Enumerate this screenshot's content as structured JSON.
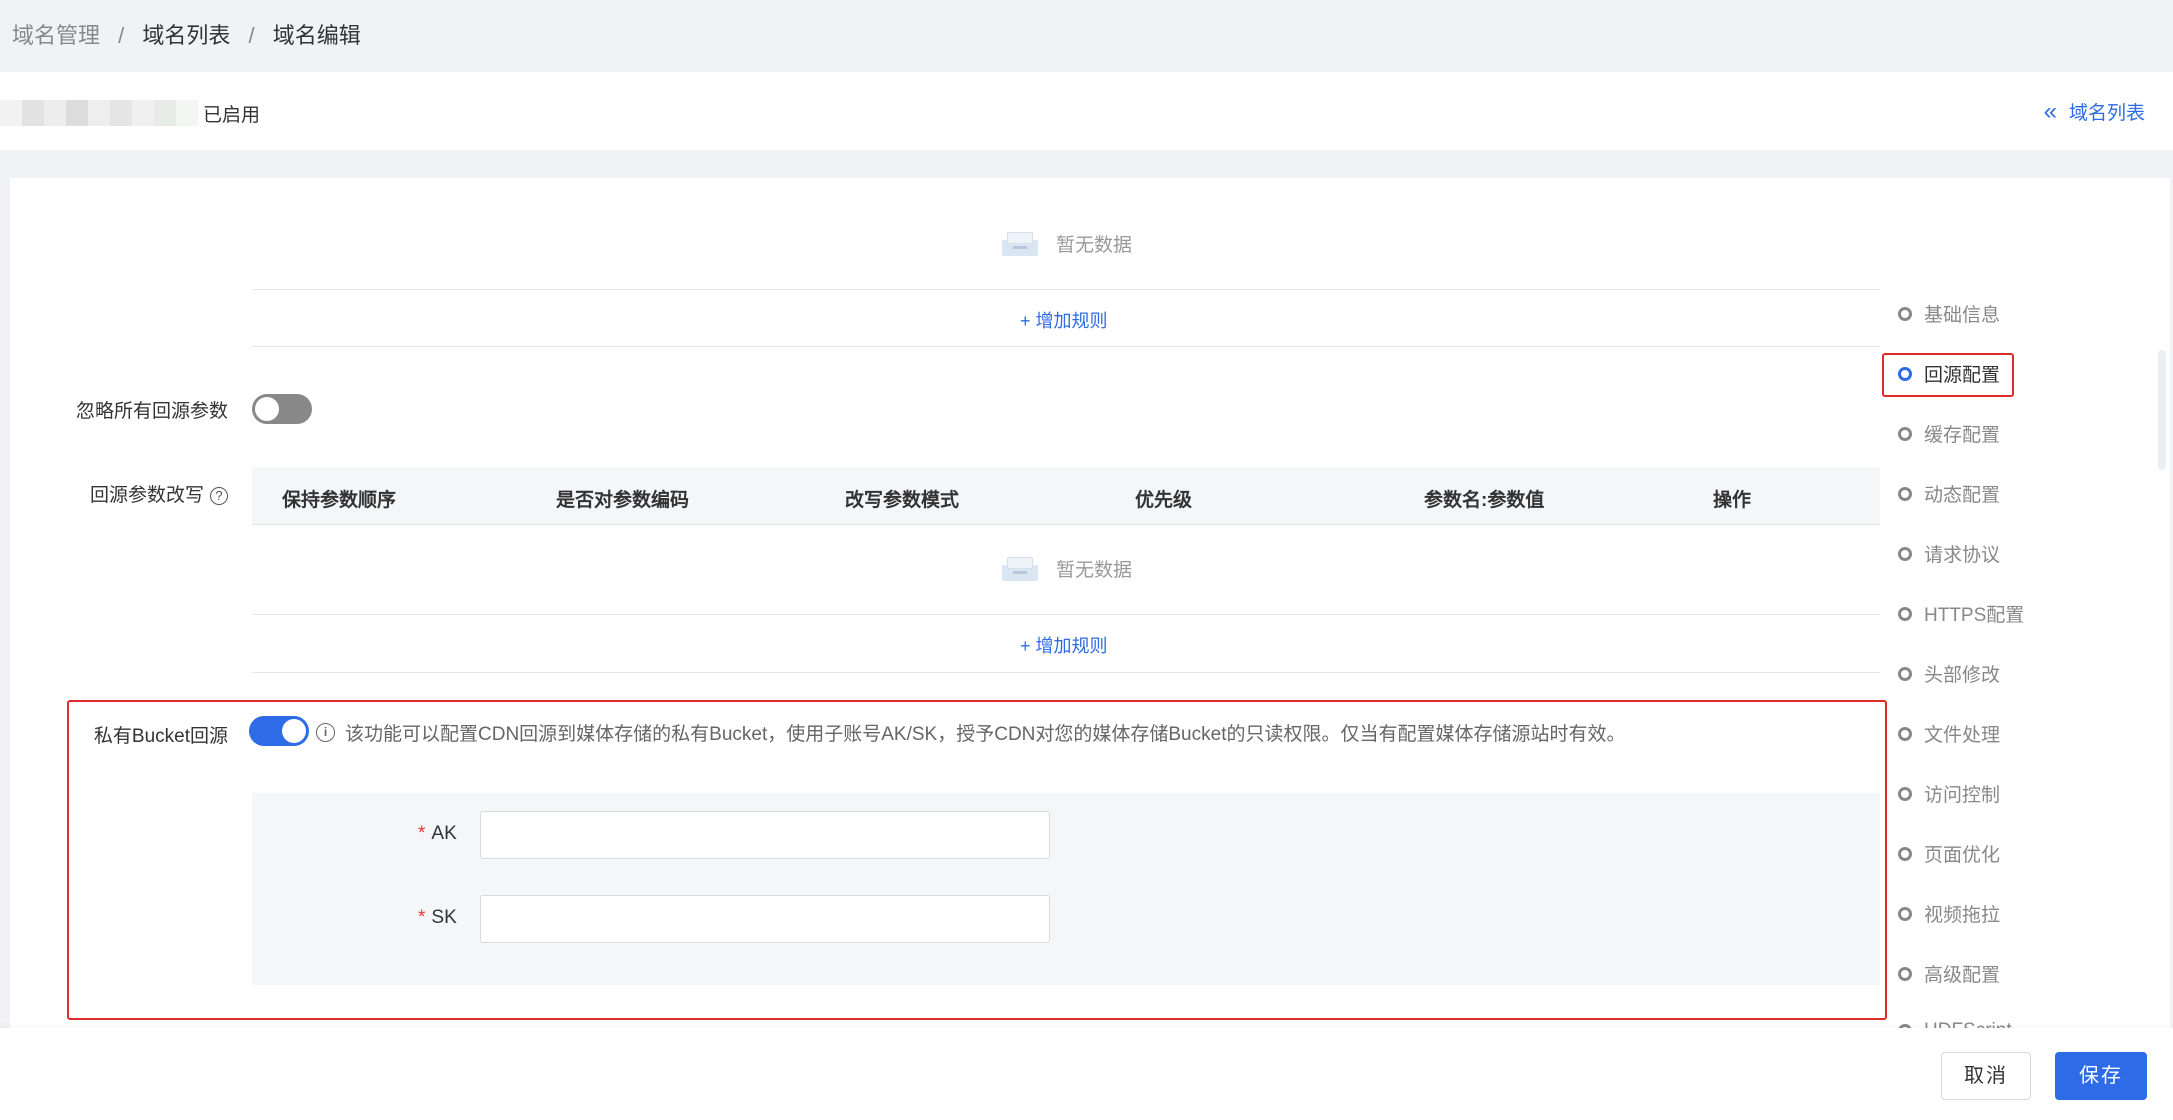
{
  "breadcrumb": {
    "items": [
      "域名管理",
      "域名列表",
      "域名编辑"
    ],
    "separator": "/"
  },
  "header": {
    "status": "已启用",
    "back_link": "域名列表"
  },
  "sections": {
    "empty_text": "暂无数据",
    "add_rule": "+ 增加规则"
  },
  "ignore_params": {
    "label": "忽略所有回源参数",
    "enabled": false
  },
  "param_rewrite": {
    "label": "回源参数改写",
    "columns": [
      "保持参数顺序",
      "是否对参数编码",
      "改写参数模式",
      "优先级",
      "参数名:参数值",
      "操作"
    ],
    "rows": []
  },
  "private_bucket": {
    "label": "私有Bucket回源",
    "enabled": true,
    "info": "该功能可以配置CDN回源到媒体存储的私有Bucket，使用子账号AK/SK，授予CDN对您的媒体存储Bucket的只读权限。仅当有配置媒体存储源站时有效。",
    "fields": [
      {
        "label": "AK",
        "required_mark": "*",
        "value": ""
      },
      {
        "label": "SK",
        "required_mark": "*",
        "value": ""
      }
    ]
  },
  "anchor_nav": {
    "items": [
      "基础信息",
      "回源配置",
      "缓存配置",
      "动态配置",
      "请求协议",
      "HTTPS配置",
      "头部修改",
      "文件处理",
      "访问控制",
      "页面优化",
      "视频拖拉",
      "高级配置",
      "HDFScript"
    ],
    "active": "回源配置"
  },
  "footer": {
    "cancel": "取消",
    "save": "保存"
  },
  "colors": {
    "accent": "#2e6be6",
    "highlight_box": "#e02b2b",
    "required": "#e33333"
  }
}
